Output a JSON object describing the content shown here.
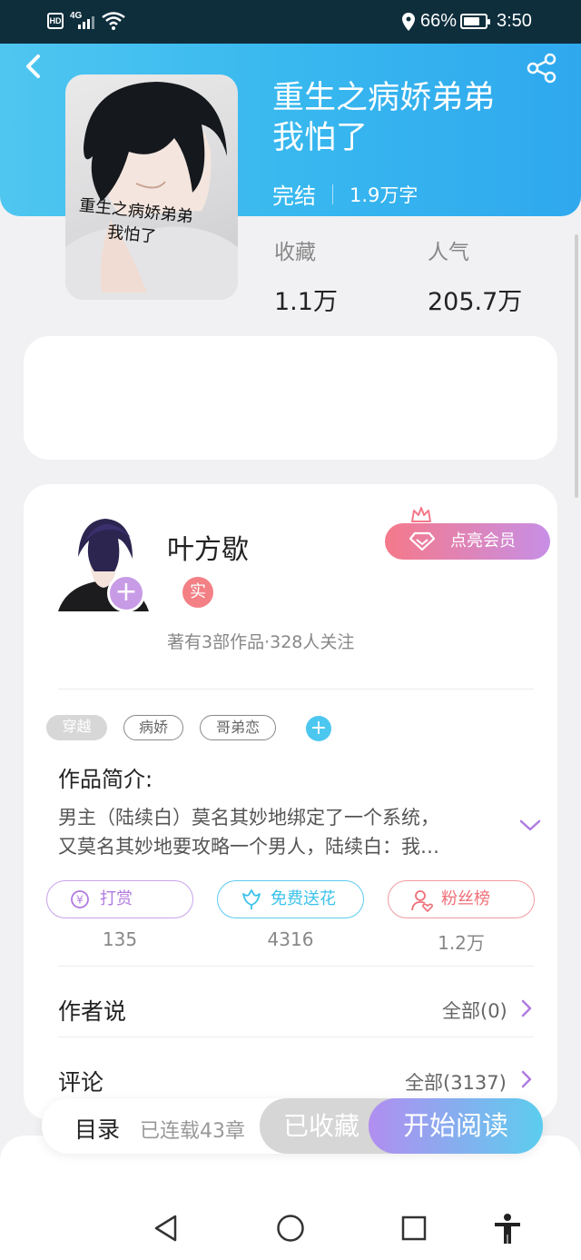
{
  "status_bar": {
    "hd": "HD",
    "network": "4G",
    "battery_percent": "66%",
    "time": "3:50",
    "icons": [
      "wifi-icon",
      "location-icon",
      "battery-icon"
    ]
  },
  "header": {
    "back_icon": "back-icon",
    "share_icon": "share-icon",
    "accent_color": "#38b8ef"
  },
  "book": {
    "cover_text": "重生之病娇弟弟\n我怕了",
    "title": "重生之病娇弟弟我怕了",
    "status": "完结",
    "word_count": "1.9万字",
    "stats": [
      {
        "label": "收藏",
        "value": "1.1万"
      },
      {
        "label": "人气",
        "value": "205.7万"
      }
    ]
  },
  "author": {
    "name": "叶方歇",
    "verified_badge": "实",
    "stats_text": "著有3部作品·328人关注",
    "vip_button": "点亮会员"
  },
  "tags": [
    "穿越",
    "病娇",
    "哥弟恋"
  ],
  "intro": {
    "title": "作品简介:",
    "lines": [
      "男主（陆续白）莫名其妙地绑定了一个系统，",
      "又莫名其妙地要攻略一个男人，陆续白：我…"
    ]
  },
  "actions": [
    {
      "label": "打赏",
      "count": "135",
      "icon": "coin-icon",
      "color": "#b07be0"
    },
    {
      "label": "免费送花",
      "count": "4316",
      "icon": "flower-icon",
      "color": "#3cc2ea"
    },
    {
      "label": "粉丝榜",
      "count": "1.2万",
      "icon": "fan-icon",
      "color": "#ef6f78"
    }
  ],
  "sections": [
    {
      "title": "作者说",
      "link": "全部(0)"
    },
    {
      "title": "评论",
      "link": "全部(3137)"
    }
  ],
  "bottom_bar": {
    "catalog": "目录",
    "chapters": "已连载43章",
    "collected": "已收藏",
    "read": "开始阅读"
  },
  "nav": [
    "back-nav-icon",
    "home-nav-icon",
    "recents-nav-icon",
    "accessibility-icon"
  ]
}
